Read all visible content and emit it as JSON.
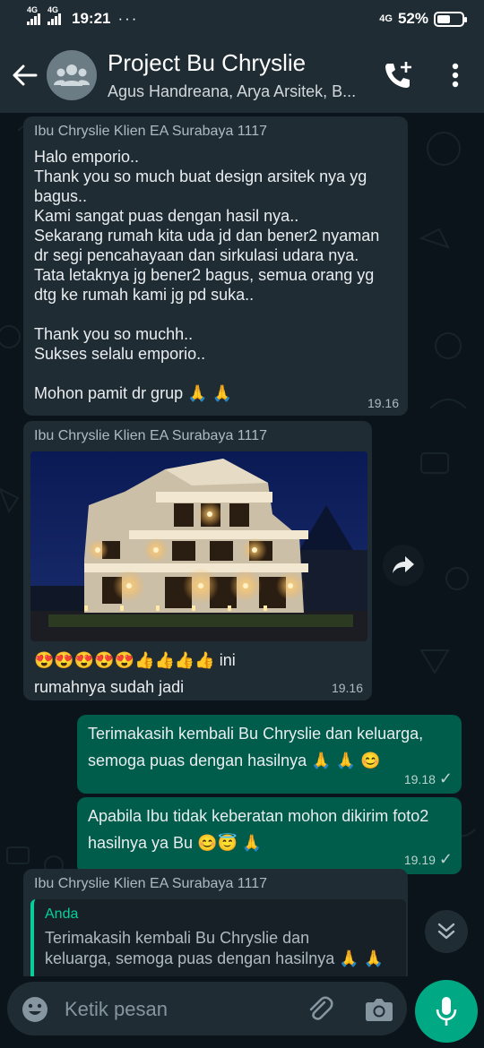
{
  "status_bar": {
    "network_1": "4G",
    "network_2": "4G",
    "time": "19:21",
    "more": "···",
    "network_right": "4G",
    "battery": "52%",
    "battery_level": 0.52
  },
  "header": {
    "title": "Project Bu Chryslie",
    "subtitle": "Agus Handreana, Arya Arsitek, B..."
  },
  "messages": [
    {
      "sender": "Ibu Chryslie Klien EA Surabaya 1117",
      "lines": [
        "Halo emporio..",
        "Thank you so much buat design arsitek nya yg",
        "bagus..",
        "Kami sangat puas dengan hasil nya..",
        "Sekarang rumah kita uda jd dan bener2 nyaman",
        "dr segi pencahayaan dan sirkulasi udara nya.",
        "Tata letaknya jg bener2 bagus, semua orang yg",
        "dtg ke rumah kami jg pd suka..",
        "",
        "Thank you so muchh..",
        "Sukses selalu emporio..",
        "",
        "Mohon pamit dr grup 🙏 🙏"
      ],
      "time": "19.16"
    },
    {
      "sender": "Ibu Chryslie Klien EA Surabaya 1117",
      "caption_line1": "😍😍😍😍😍👍👍👍👍  ini",
      "caption_line2": "rumahnya sudah jadi",
      "time": "19.16"
    },
    {
      "lines": [
        "Terimakasih kembali Bu Chryslie dan keluarga,",
        "semoga puas dengan hasilnya 🙏 🙏 😊"
      ],
      "time": "19.18",
      "tick": "✓"
    },
    {
      "lines": [
        "Apabila Ibu tidak keberatan mohon dikirim foto2",
        "hasilnya ya Bu 😊😇 🙏"
      ],
      "time": "19.19",
      "tick": "✓"
    },
    {
      "sender": "Ibu Chryslie Klien EA Surabaya 1117",
      "quote_name": "Anda",
      "quote_lines": [
        "Terimakasih kembali Bu Chryslie dan",
        "keluarga, semoga puas dengan hasilnya 🙏 🙏"
      ]
    }
  ],
  "input": {
    "placeholder": "Ketik pesan"
  },
  "icons": {
    "back": "arrow-left-icon",
    "group_avatar": "group-icon",
    "add_call": "add-call-icon",
    "menu": "more-vert-icon",
    "forward": "forward-icon",
    "scroll_down": "double-chevron-down-icon",
    "emoji": "emoji-icon",
    "attach": "paperclip-icon",
    "camera": "camera-icon",
    "mic": "mic-icon"
  },
  "colors": {
    "header_bg": "#1f2c34",
    "chat_bg": "#0b141a",
    "incoming_bubble": "#1f2c34",
    "outgoing_bubble": "#005c4b",
    "accent": "#00a884"
  }
}
